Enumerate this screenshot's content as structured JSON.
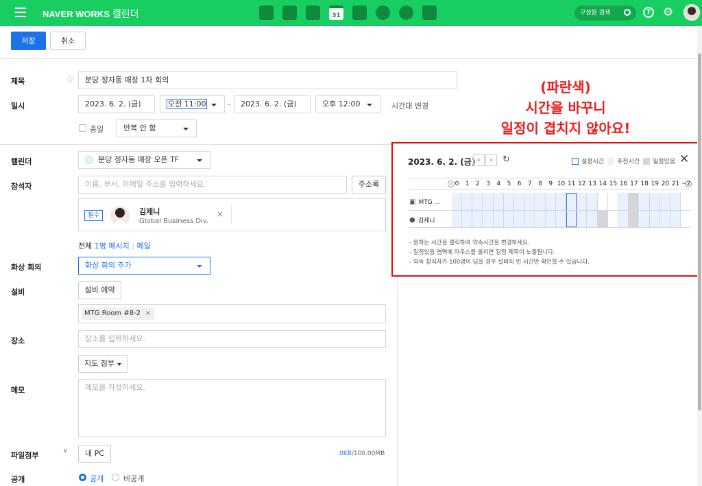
{
  "topbar": {
    "brand": "NAVER WORKS",
    "app": "캘린더",
    "calendar_day": "31",
    "search_label": "구성원 검색",
    "help": "?"
  },
  "toolbar": {
    "save": "저장",
    "cancel": "취소"
  },
  "form": {
    "title_label": "제목",
    "title_value": "분당 정자동 매장 1차 회의",
    "datetime_label": "일시",
    "start_date": "2023. 6. 2. (금)",
    "start_time": "오전 11:00",
    "dash": "-",
    "end_date": "2023. 6. 2. (금)",
    "end_time": "오후 12:00",
    "timezone_link": "시간대 변경",
    "allday_label": "종일",
    "repeat_value": "반복 안 함",
    "calendar_label": "캘린더",
    "calendar_value": "분당 정자동 매장 오픈 TF",
    "attendee_label": "참석자",
    "attendee_placeholder": "이름, 부서, 이메일 주소를 입력하세요.",
    "address_book": "주소록",
    "attendee": {
      "badge": "필수",
      "name": "김제니",
      "org": "Global Business Div."
    },
    "summary_prefix": "전체",
    "summary_count": "1명",
    "summary_message": "메시지",
    "summary_sep": "|",
    "summary_mail": "메일",
    "video_label": "화상 회의",
    "video_value": "화상 회의 추가",
    "equipment_label": "설비",
    "equipment_button": "설비 예약",
    "equipment_chip": "MTG Room #8-2",
    "place_label": "장소",
    "place_placeholder": "장소를 입력하세요.",
    "map_button": "지도 첨부",
    "memo_label": "메모",
    "memo_placeholder": "메모를 작성하세요.",
    "file_label": "파일첨부",
    "file_button": "내 PC",
    "file_used": "0KB",
    "file_total": "/100.00MB",
    "visibility_label": "공개",
    "visibility_public": "공개",
    "visibility_private": "비공개"
  },
  "annotation": {
    "line1": "(파란색)",
    "line2": "시간을 바꾸니",
    "line3": "일정이 겹치지 않아요!"
  },
  "scheduler": {
    "date": "2023. 6. 2. (금)",
    "legend": [
      "설정시간",
      "추천시간",
      "일정있음"
    ],
    "legend_colors": [
      "#ffffff",
      "#e9f1fd",
      "#d6d6d6"
    ],
    "hours": [
      "0",
      "1",
      "2",
      "3",
      "4",
      "5",
      "6",
      "7",
      "8",
      "9",
      "10",
      "11",
      "12",
      "13",
      "14",
      "15",
      "16",
      "17",
      "18",
      "19",
      "20",
      "21",
      "~2"
    ],
    "rows": [
      {
        "label": "MTG ...",
        "busy": [
          17
        ],
        "white": [
          14,
          15
        ]
      },
      {
        "label": "김제니",
        "busy": [
          14,
          17
        ],
        "white": [
          15
        ]
      }
    ],
    "selected_hour": 11,
    "notes": [
      "- 원하는 시간을 클릭하여 약속시간을 변경하세요.",
      "- 일정있음 영역에 마우스를 올리면 일정 제목이 노출됩니다.",
      "- 약속 참석자가 100명이 넘을 경우 설비의 빈 시간만 확인할 수 있습니다."
    ]
  }
}
